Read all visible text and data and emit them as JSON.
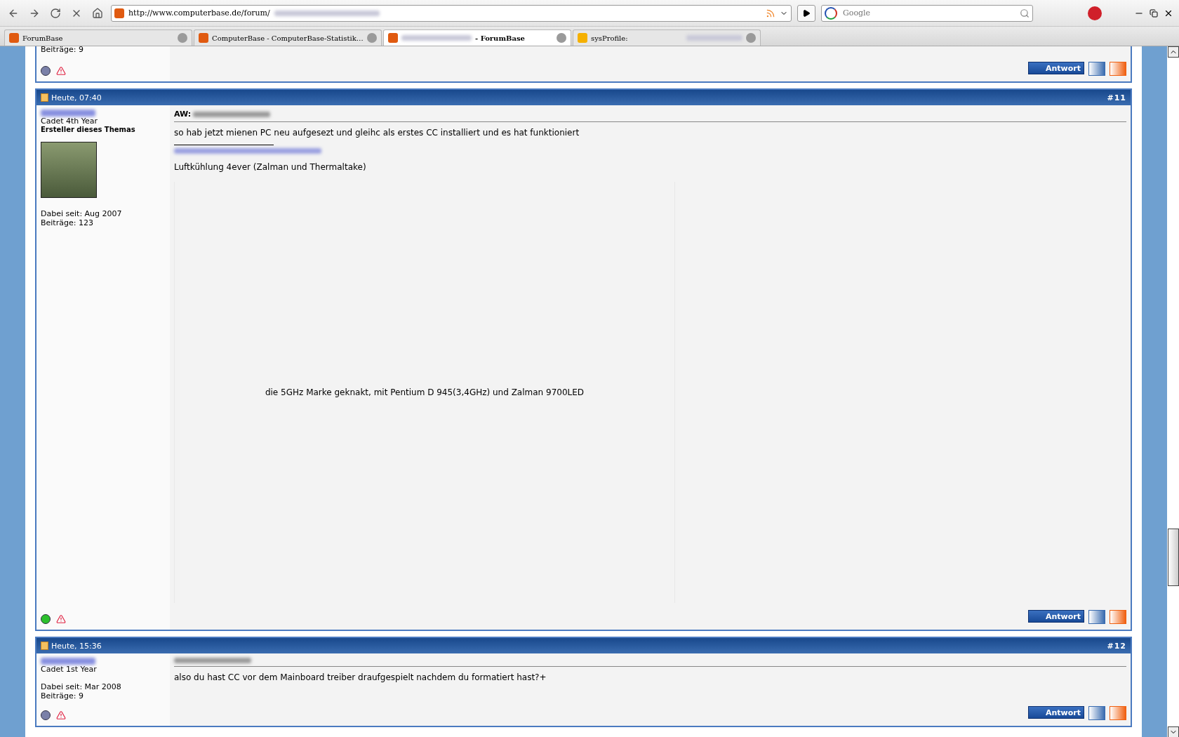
{
  "browser": {
    "url": "http://www.computerbase.de/forum/",
    "search": {
      "placeholder": "Google"
    },
    "tabs": [
      {
        "title": "ForumBase",
        "selected": false,
        "redacted_prefix": false,
        "redacted_suffix": false,
        "kind": "cb"
      },
      {
        "title": "ComputerBase - ComputerBase-Statistik…",
        "selected": false,
        "redacted_prefix": false,
        "redacted_suffix": false,
        "kind": "cb"
      },
      {
        "title": "- ForumBase",
        "selected": true,
        "redacted_prefix": true,
        "redacted_suffix": false,
        "kind": "cb"
      },
      {
        "title": "sysProfile:",
        "selected": false,
        "redacted_prefix": false,
        "redacted_suffix": true,
        "kind": "sys"
      }
    ]
  },
  "posts": [
    {
      "kind": "partial",
      "stats": [
        "Beiträge: 9"
      ],
      "online": false,
      "reply": "Antwort"
    },
    {
      "kind": "full",
      "date": "Heute, 07:40",
      "number": "#11",
      "rank": "Cadet 4th Year",
      "badge": "Ersteller dieses Themas",
      "has_avatar": true,
      "stats": [
        "Dabei seit: Aug 2007",
        "Beiträge: 123"
      ],
      "title_prefix": "AW:",
      "body": "so hab jetzt mienen PC neu aufgesezt und gleihc als erstes CC installiert und es hat funktioniert",
      "signature": {
        "text": "Luftkühlung 4ever (Zalman und Thermaltake)",
        "banner": "die 5GHz Marke geknakt, mit Pentium D 945(3,4GHz) und Zalman 9700LED"
      },
      "online": true,
      "reply": "Antwort"
    },
    {
      "kind": "full",
      "date": "Heute, 15:36",
      "number": "#12",
      "rank": "Cadet 1st Year",
      "has_avatar": false,
      "stats": [
        "Dabei seit: Mar 2008",
        "Beiträge: 9"
      ],
      "body": "also du hast CC vor dem Mainboard treiber draufgespielt nachdem du formatiert hast?+",
      "online": false,
      "reply": "Antwort"
    }
  ]
}
